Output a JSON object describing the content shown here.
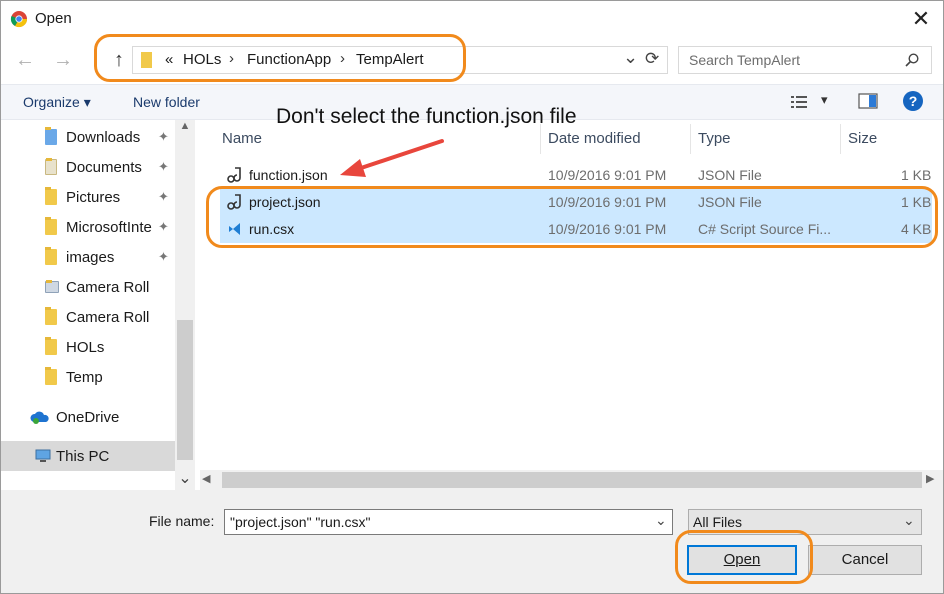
{
  "window": {
    "title": "Open",
    "close_glyph": "✕"
  },
  "nav": {
    "back_glyph": "←",
    "forward_glyph": "→",
    "up_glyph": "↑",
    "breadcrumb_overflow": "«",
    "breadcrumb": [
      "HOLs",
      "FunctionApp",
      "TempAlert"
    ],
    "separator": "›",
    "dropdown_glyph": "⌄",
    "refresh_glyph": "⟳"
  },
  "search": {
    "placeholder": "Search TempAlert"
  },
  "toolbar": {
    "organize_label": "Organize ▾",
    "new_folder_label": "New folder",
    "view_glyph": "▾",
    "help_glyph": "?"
  },
  "sidebar": {
    "items": [
      {
        "label": "Downloads",
        "icon": "downloads-folder-icon",
        "pinned": true
      },
      {
        "label": "Documents",
        "icon": "documents-folder-icon",
        "pinned": true
      },
      {
        "label": "Pictures",
        "icon": "pictures-folder-icon",
        "pinned": true
      },
      {
        "label": "MicrosoftInte",
        "icon": "folder-icon",
        "pinned": true
      },
      {
        "label": "images",
        "icon": "folder-icon",
        "pinned": true
      },
      {
        "label": "Camera Roll",
        "icon": "camera-roll-icon",
        "pinned": false
      },
      {
        "label": "Camera Roll",
        "icon": "folder-icon",
        "pinned": false
      },
      {
        "label": "HOLs",
        "icon": "folder-icon",
        "pinned": false
      },
      {
        "label": "Temp",
        "icon": "folder-icon",
        "pinned": false
      }
    ],
    "onedrive_label": "OneDrive",
    "thispc_label": "This PC",
    "pin_glyph": "📌",
    "scroll_down_glyph": "⌄"
  },
  "file_list": {
    "columns": [
      "Name",
      "Date modified",
      "Type",
      "Size"
    ],
    "rows": [
      {
        "name": "function.json",
        "date": "10/9/2016 9:01 PM",
        "type": "JSON File",
        "size": "1 KB",
        "selected": false,
        "icon": "json-file-icon"
      },
      {
        "name": "project.json",
        "date": "10/9/2016 9:01 PM",
        "type": "JSON File",
        "size": "1 KB",
        "selected": true,
        "icon": "json-file-icon"
      },
      {
        "name": "run.csx",
        "date": "10/9/2016 9:01 PM",
        "type": "C# Script Source Fi...",
        "size": "4 KB",
        "selected": true,
        "icon": "vscode-file-icon"
      }
    ]
  },
  "footer": {
    "filename_label": "File name:",
    "filename_value": "\"project.json\" \"run.csx\"",
    "filetype_value": "All Files",
    "open_label": "Open",
    "cancel_label": "Cancel"
  },
  "annotation": {
    "text": "Don't select the function.json file",
    "highlight_color": "#f18a1c",
    "arrow_color": "#e8463c"
  },
  "colors": {
    "selection": "#cce8ff",
    "accent": "#0078d7"
  }
}
